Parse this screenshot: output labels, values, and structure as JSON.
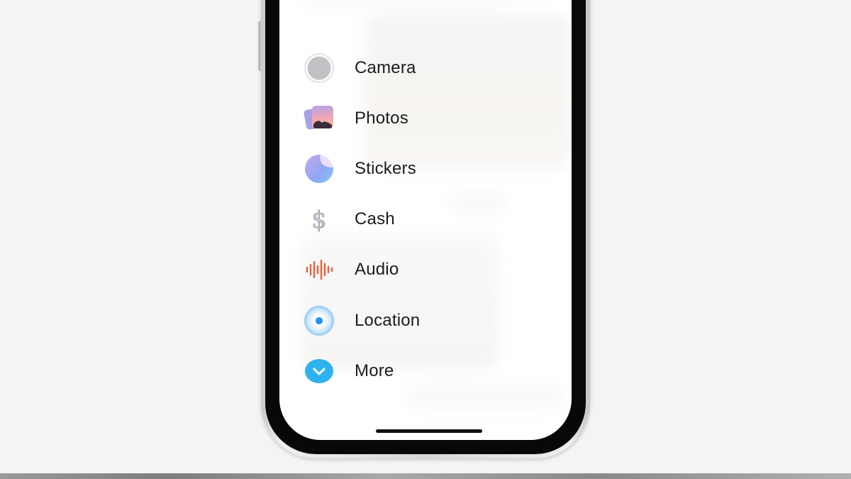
{
  "menu": {
    "items": [
      {
        "label": "Camera",
        "icon": "camera-icon"
      },
      {
        "label": "Photos",
        "icon": "photos-icon"
      },
      {
        "label": "Stickers",
        "icon": "stickers-icon"
      },
      {
        "label": "Cash",
        "icon": "cash-icon"
      },
      {
        "label": "Audio",
        "icon": "audio-icon"
      },
      {
        "label": "Location",
        "icon": "location-icon"
      },
      {
        "label": "More",
        "icon": "chevron-down-icon"
      }
    ]
  },
  "colors": {
    "camera": "#c2c2c6",
    "audio": "#e9603f",
    "location": "#1e90ff",
    "more": "#2fb2f0",
    "label": "#1c1c1e"
  }
}
